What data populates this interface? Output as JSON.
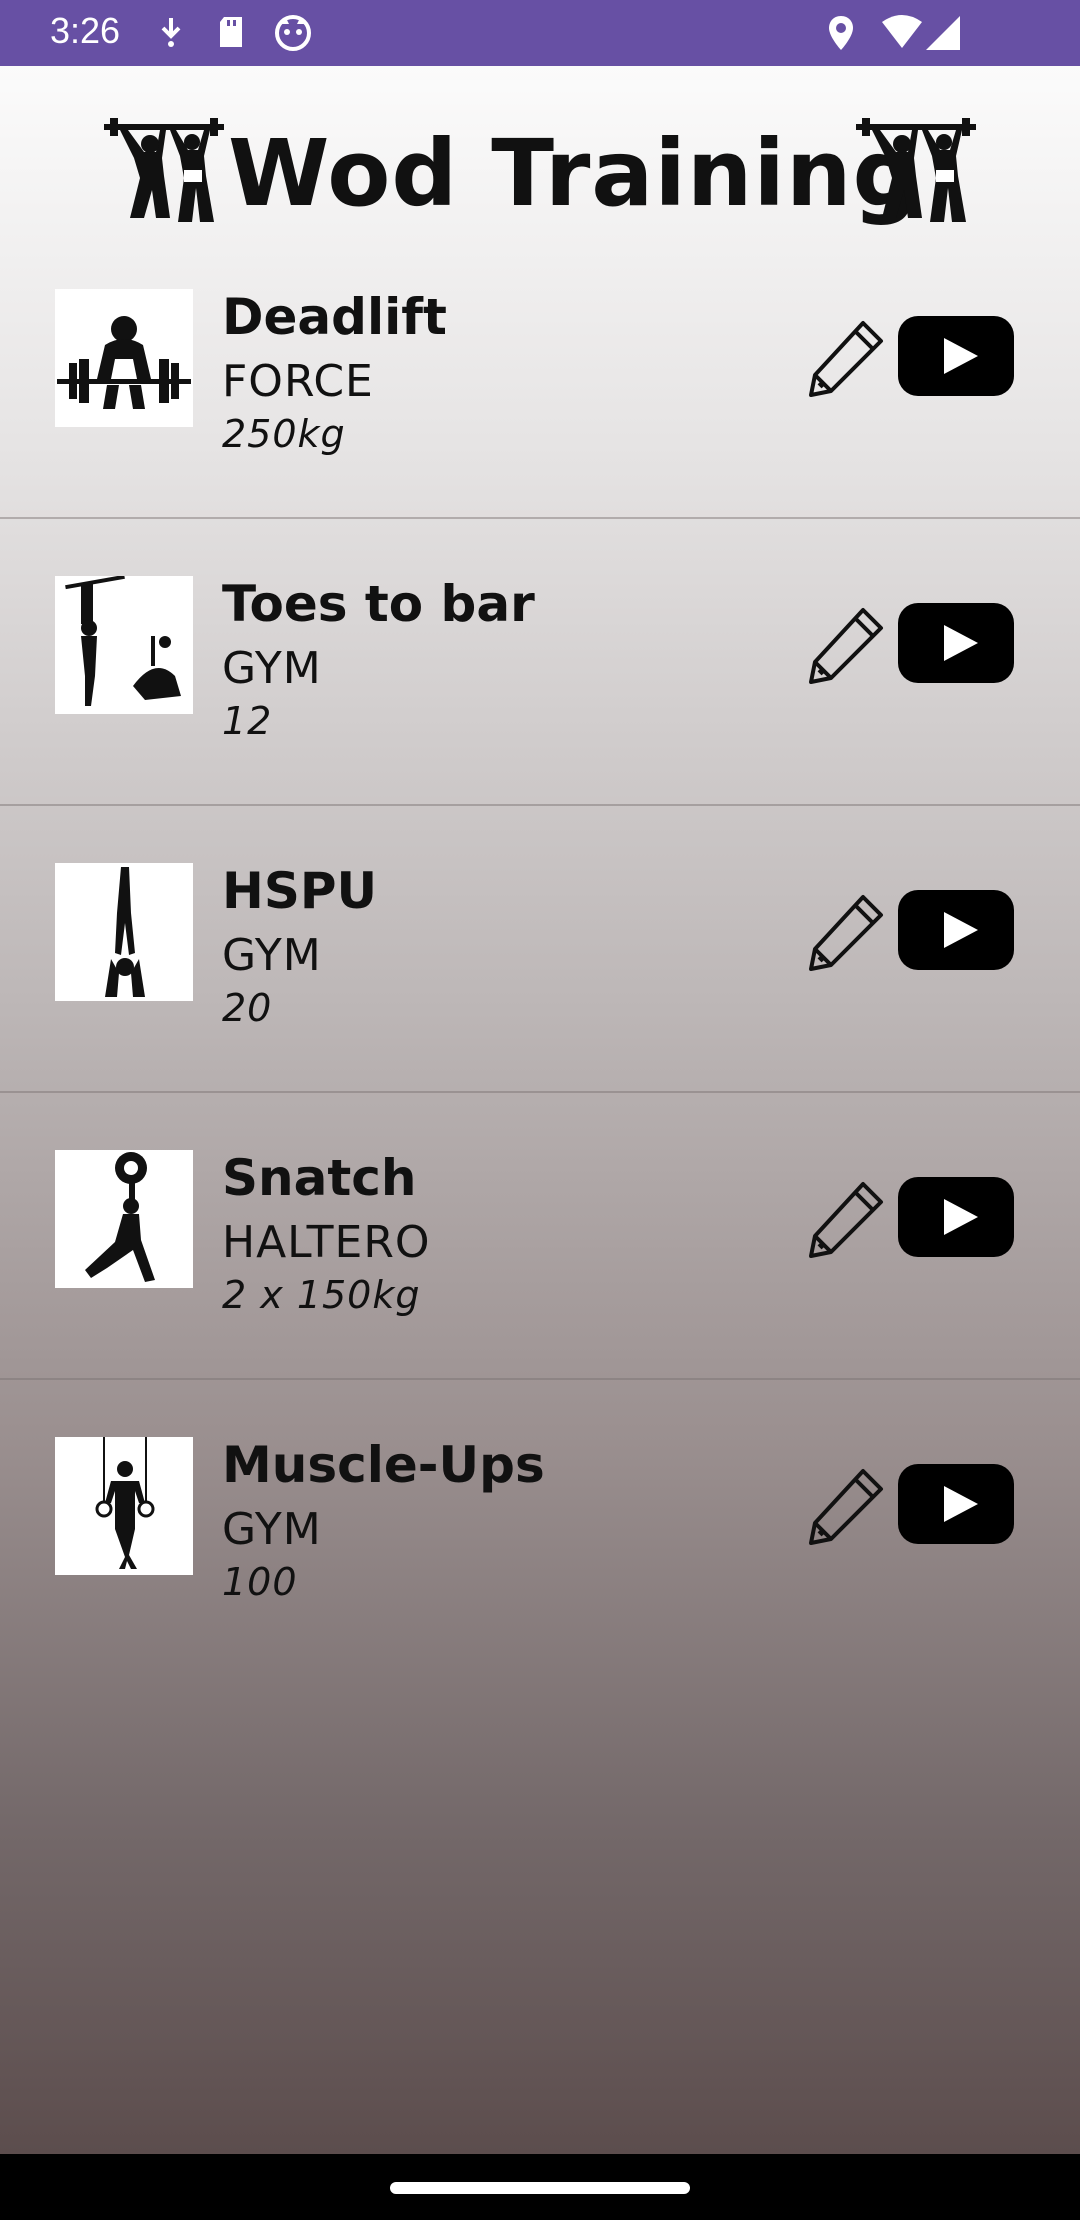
{
  "status_bar": {
    "time": "3:26"
  },
  "header": {
    "title": "Wod Training"
  },
  "exercises": [
    {
      "name": "Deadlift",
      "category": "FORCE",
      "amount": "250kg",
      "thumb_icon": "deadlift-icon"
    },
    {
      "name": "Toes to bar",
      "category": "GYM",
      "amount": "12",
      "thumb_icon": "toes-to-bar-icon"
    },
    {
      "name": "HSPU",
      "category": "GYM",
      "amount": "20",
      "thumb_icon": "handstand-icon"
    },
    {
      "name": "Snatch",
      "category": "HALTERO",
      "amount": "2 x 150kg",
      "thumb_icon": "snatch-icon"
    },
    {
      "name": "Muscle-Ups",
      "category": "GYM",
      "amount": "100",
      "thumb_icon": "rings-icon"
    }
  ],
  "colors": {
    "status_bar": "#6750a4",
    "text": "#111111",
    "nav_bar": "#000000"
  }
}
